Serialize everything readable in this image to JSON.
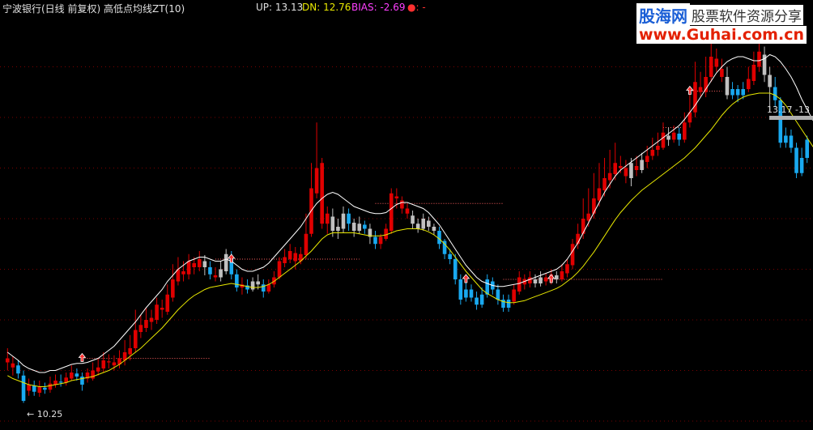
{
  "header": {
    "title": "宁波银行(日线 前复权) 高低点均线ZT(10)",
    "up_label": "UP: 13.13",
    "dn_label": "DN: 12.76",
    "bias_label": "BIAS: -2.69",
    "dot_label": "●: -"
  },
  "watermark": {
    "brand": "股海网",
    "tagline": "股票软件资源分享",
    "url": "www.Guhai.com.cn"
  },
  "colors": {
    "background": "#000000",
    "up_candle": "#e00000",
    "down_candle": "#19a9f0",
    "neutral_candle": "#c0c0c0",
    "upper_line": "#ffffff",
    "lower_line": "#e8e800",
    "grid": "#7a0000",
    "signal": "#ff6060"
  },
  "chart_data": {
    "type": "candlestick",
    "ylim": [
      10.0,
      14.0
    ],
    "grid": true,
    "annotations": {
      "low_label": "← 10.25",
      "high_label": "13.17 -13"
    },
    "candles": [
      [
        10.62,
        10.58,
        10.72,
        10.5,
        "r"
      ],
      [
        10.57,
        10.53,
        10.64,
        10.45,
        "r"
      ],
      [
        10.55,
        10.47,
        10.6,
        10.42,
        "b"
      ],
      [
        10.45,
        10.2,
        10.5,
        10.18,
        "b"
      ],
      [
        10.3,
        10.36,
        10.42,
        10.25,
        "r"
      ],
      [
        10.35,
        10.29,
        10.4,
        10.25,
        "b"
      ],
      [
        10.28,
        10.34,
        10.4,
        10.24,
        "r"
      ],
      [
        10.33,
        10.31,
        10.38,
        10.27,
        "b"
      ],
      [
        10.31,
        10.37,
        10.44,
        10.28,
        "r"
      ],
      [
        10.36,
        10.4,
        10.46,
        10.33,
        "r"
      ],
      [
        10.39,
        10.38,
        10.46,
        10.34,
        "b"
      ],
      [
        10.38,
        10.43,
        10.48,
        10.35,
        "r"
      ],
      [
        10.42,
        10.48,
        10.55,
        10.4,
        "r"
      ],
      [
        10.47,
        10.44,
        10.52,
        10.4,
        "b"
      ],
      [
        10.44,
        10.36,
        10.48,
        10.3,
        "b"
      ],
      [
        10.42,
        10.48,
        10.52,
        10.38,
        "r"
      ],
      [
        10.42,
        10.5,
        10.58,
        10.4,
        "r"
      ],
      [
        10.49,
        10.53,
        10.62,
        10.45,
        "r"
      ],
      [
        10.52,
        10.6,
        10.68,
        10.48,
        "r"
      ],
      [
        10.59,
        10.58,
        10.66,
        10.52,
        "r"
      ],
      [
        10.58,
        10.55,
        10.65,
        10.5,
        "r"
      ],
      [
        10.56,
        10.62,
        10.7,
        10.52,
        "r"
      ],
      [
        10.6,
        10.68,
        10.8,
        10.55,
        "r"
      ],
      [
        10.66,
        10.72,
        10.85,
        10.6,
        "r"
      ],
      [
        10.72,
        10.9,
        11.1,
        10.68,
        "r"
      ],
      [
        10.88,
        10.95,
        11.05,
        10.82,
        "r"
      ],
      [
        10.92,
        11.0,
        11.12,
        10.88,
        "r"
      ],
      [
        10.98,
        11.02,
        11.1,
        10.9,
        "r"
      ],
      [
        11.0,
        11.15,
        11.22,
        10.96,
        "r"
      ],
      [
        11.12,
        11.1,
        11.2,
        11.02,
        "r"
      ],
      [
        11.08,
        11.25,
        11.35,
        11.05,
        "r"
      ],
      [
        11.22,
        11.4,
        11.55,
        11.18,
        "r"
      ],
      [
        11.38,
        11.5,
        11.62,
        11.34,
        "r"
      ],
      [
        11.48,
        11.45,
        11.58,
        11.38,
        "r"
      ],
      [
        11.45,
        11.58,
        11.65,
        11.4,
        "r"
      ],
      [
        11.56,
        11.52,
        11.62,
        11.45,
        "r"
      ],
      [
        11.52,
        11.6,
        11.68,
        11.48,
        "r"
      ],
      [
        11.58,
        11.52,
        11.64,
        11.44,
        "g"
      ],
      [
        11.52,
        11.45,
        11.58,
        11.4,
        "b"
      ],
      [
        11.44,
        11.42,
        11.52,
        11.38,
        "r"
      ],
      [
        11.42,
        11.5,
        11.58,
        11.38,
        "g"
      ],
      [
        11.48,
        11.65,
        11.7,
        11.45,
        "g"
      ],
      [
        11.62,
        11.45,
        11.68,
        11.4,
        "b"
      ],
      [
        11.45,
        11.32,
        11.5,
        11.28,
        "b"
      ],
      [
        11.32,
        11.35,
        11.42,
        11.25,
        "r"
      ],
      [
        11.34,
        11.3,
        11.4,
        11.26,
        "b"
      ],
      [
        11.3,
        11.38,
        11.42,
        11.28,
        "g"
      ],
      [
        11.38,
        11.35,
        11.45,
        11.3,
        "g"
      ],
      [
        11.35,
        11.28,
        11.4,
        11.22,
        "b"
      ],
      [
        11.28,
        11.35,
        11.4,
        11.26,
        "r"
      ],
      [
        11.35,
        11.42,
        11.48,
        11.32,
        "r"
      ],
      [
        11.42,
        11.58,
        11.62,
        11.4,
        "r"
      ],
      [
        11.56,
        11.62,
        11.7,
        11.52,
        "r"
      ],
      [
        11.6,
        11.68,
        11.75,
        11.56,
        "r"
      ],
      [
        11.66,
        11.58,
        11.72,
        11.5,
        "r"
      ],
      [
        11.58,
        11.65,
        11.72,
        11.55,
        "r"
      ],
      [
        11.64,
        11.85,
        12.05,
        11.6,
        "r"
      ],
      [
        11.85,
        12.3,
        12.55,
        11.82,
        "r"
      ],
      [
        12.25,
        12.5,
        12.95,
        12.2,
        "r"
      ],
      [
        12.55,
        11.95,
        12.6,
        11.9,
        "r"
      ],
      [
        11.95,
        12.05,
        12.12,
        11.85,
        "r"
      ],
      [
        12.02,
        11.88,
        12.1,
        11.82,
        "g"
      ],
      [
        11.88,
        11.92,
        12.0,
        11.8,
        "g"
      ],
      [
        11.9,
        12.05,
        12.12,
        11.86,
        "g"
      ],
      [
        12.05,
        11.95,
        12.1,
        11.88,
        "b"
      ],
      [
        11.96,
        11.88,
        12.0,
        11.82,
        "g"
      ],
      [
        11.88,
        11.95,
        12.02,
        11.85,
        "g"
      ],
      [
        11.94,
        11.9,
        11.98,
        11.85,
        "b"
      ],
      [
        11.9,
        11.82,
        11.95,
        11.75,
        "g"
      ],
      [
        11.82,
        11.75,
        11.88,
        11.7,
        "b"
      ],
      [
        11.75,
        11.82,
        11.85,
        11.7,
        "r"
      ],
      [
        11.8,
        11.9,
        11.95,
        11.78,
        "r"
      ],
      [
        11.88,
        12.25,
        12.3,
        11.85,
        "r"
      ],
      [
        12.22,
        12.2,
        12.3,
        12.1,
        "r"
      ],
      [
        12.18,
        12.1,
        12.22,
        12.05,
        "r"
      ],
      [
        12.1,
        12.05,
        12.15,
        12.0,
        "r"
      ],
      [
        12.03,
        11.95,
        12.08,
        11.9,
        "g"
      ],
      [
        11.95,
        11.9,
        12.0,
        11.86,
        "g"
      ],
      [
        11.9,
        12.0,
        12.05,
        11.88,
        "g"
      ],
      [
        11.98,
        11.92,
        12.02,
        11.88,
        "g"
      ],
      [
        11.92,
        11.88,
        11.95,
        11.84,
        "g"
      ],
      [
        11.88,
        11.75,
        11.92,
        11.7,
        "b"
      ],
      [
        11.78,
        11.65,
        11.8,
        11.6,
        "b"
      ],
      [
        11.65,
        11.6,
        11.7,
        11.55,
        "b"
      ],
      [
        11.6,
        11.4,
        11.65,
        11.35,
        "b"
      ],
      [
        11.4,
        11.2,
        11.45,
        11.15,
        "b"
      ],
      [
        11.22,
        11.3,
        11.38,
        11.18,
        "b"
      ],
      [
        11.3,
        11.22,
        11.35,
        11.18,
        "b"
      ],
      [
        11.22,
        11.15,
        11.28,
        11.1,
        "b"
      ],
      [
        11.15,
        11.25,
        11.32,
        11.12,
        "b"
      ],
      [
        11.25,
        11.4,
        11.45,
        11.22,
        "b"
      ],
      [
        11.38,
        11.3,
        11.42,
        11.25,
        "b"
      ],
      [
        11.3,
        11.2,
        11.35,
        11.15,
        "b"
      ],
      [
        11.2,
        11.12,
        11.25,
        11.08,
        "b"
      ],
      [
        11.12,
        11.2,
        11.25,
        11.08,
        "b"
      ],
      [
        11.18,
        11.3,
        11.35,
        11.15,
        "r"
      ],
      [
        11.28,
        11.42,
        11.48,
        11.25,
        "r"
      ],
      [
        11.4,
        11.35,
        11.45,
        11.3,
        "r"
      ],
      [
        11.36,
        11.42,
        11.48,
        11.32,
        "r"
      ],
      [
        11.4,
        11.36,
        11.45,
        11.32,
        "g"
      ],
      [
        11.36,
        11.42,
        11.48,
        11.33,
        "g"
      ],
      [
        11.42,
        11.38,
        11.46,
        11.34,
        "r"
      ],
      [
        11.38,
        11.45,
        11.5,
        11.35,
        "r"
      ],
      [
        11.44,
        11.4,
        11.48,
        11.36,
        "g"
      ],
      [
        11.4,
        11.48,
        11.55,
        11.38,
        "r"
      ],
      [
        11.46,
        11.55,
        11.6,
        11.42,
        "r"
      ],
      [
        11.54,
        11.75,
        11.8,
        11.5,
        "r"
      ],
      [
        11.75,
        11.85,
        11.95,
        11.7,
        "r"
      ],
      [
        11.85,
        12.0,
        12.2,
        11.8,
        "r"
      ],
      [
        11.98,
        12.05,
        12.3,
        11.92,
        "r"
      ],
      [
        12.05,
        12.2,
        12.45,
        12.0,
        "r"
      ],
      [
        12.18,
        12.3,
        12.55,
        12.12,
        "r"
      ],
      [
        12.28,
        12.4,
        12.6,
        12.22,
        "r"
      ],
      [
        12.38,
        12.45,
        12.68,
        12.3,
        "r"
      ],
      [
        12.44,
        12.55,
        12.75,
        12.38,
        "r"
      ],
      [
        12.52,
        12.5,
        12.62,
        12.45,
        "r"
      ],
      [
        12.5,
        12.42,
        12.58,
        12.35,
        "r"
      ],
      [
        12.4,
        12.55,
        12.6,
        12.32,
        "g"
      ],
      [
        12.52,
        12.48,
        12.62,
        12.42,
        "r"
      ],
      [
        12.48,
        12.58,
        12.65,
        12.45,
        "g"
      ],
      [
        12.56,
        12.62,
        12.72,
        12.5,
        "r"
      ],
      [
        12.62,
        12.68,
        12.8,
        12.58,
        "r"
      ],
      [
        12.68,
        12.72,
        12.85,
        12.62,
        "r"
      ],
      [
        12.7,
        12.85,
        12.95,
        12.68,
        "r"
      ],
      [
        12.82,
        12.78,
        12.9,
        12.72,
        "g"
      ],
      [
        12.78,
        12.85,
        12.92,
        12.75,
        "r"
      ],
      [
        12.84,
        12.78,
        12.9,
        12.72,
        "b"
      ],
      [
        12.78,
        12.95,
        13.05,
        12.75,
        "r"
      ],
      [
        12.95,
        13.05,
        13.25,
        12.9,
        "r"
      ],
      [
        13.05,
        13.35,
        13.55,
        13.0,
        "r"
      ],
      [
        13.3,
        13.25,
        13.45,
        13.2,
        "r"
      ],
      [
        13.25,
        13.4,
        13.6,
        13.2,
        "r"
      ],
      [
        13.4,
        13.6,
        13.75,
        13.35,
        "r"
      ],
      [
        13.58,
        13.5,
        13.68,
        13.45,
        "r"
      ],
      [
        13.48,
        13.4,
        13.58,
        13.35,
        "r"
      ],
      [
        13.4,
        13.22,
        13.5,
        13.18,
        "g"
      ],
      [
        13.22,
        13.28,
        13.35,
        13.18,
        "b"
      ],
      [
        13.28,
        13.22,
        13.32,
        13.15,
        "b"
      ],
      [
        13.22,
        13.28,
        13.35,
        13.18,
        "b"
      ],
      [
        13.28,
        13.38,
        13.5,
        13.25,
        "r"
      ],
      [
        13.36,
        13.52,
        13.65,
        13.32,
        "r"
      ],
      [
        13.5,
        13.65,
        13.78,
        13.45,
        "r"
      ],
      [
        13.62,
        13.42,
        13.7,
        13.35,
        "g"
      ],
      [
        13.42,
        13.3,
        13.5,
        13.05,
        "g"
      ],
      [
        13.3,
        13.17,
        13.4,
        13.1,
        "b"
      ],
      [
        13.17,
        12.75,
        13.2,
        12.7,
        "b"
      ],
      [
        12.75,
        12.82,
        12.9,
        12.7,
        "b"
      ],
      [
        12.82,
        12.7,
        12.88,
        12.65,
        "b"
      ],
      [
        12.7,
        12.45,
        12.75,
        12.4,
        "b"
      ],
      [
        12.45,
        12.6,
        12.7,
        12.42,
        "b"
      ],
      [
        12.6,
        12.78,
        12.82,
        12.55,
        "b"
      ]
    ],
    "upper_line": [
      10.68,
      10.64,
      10.6,
      10.55,
      10.52,
      10.5,
      10.48,
      10.48,
      10.5,
      10.5,
      10.52,
      10.54,
      10.56,
      10.57,
      10.57,
      10.58,
      10.6,
      10.62,
      10.66,
      10.7,
      10.74,
      10.8,
      10.86,
      10.92,
      10.98,
      11.05,
      11.12,
      11.18,
      11.24,
      11.3,
      11.38,
      11.44,
      11.5,
      11.54,
      11.58,
      11.6,
      11.62,
      11.62,
      11.6,
      11.58,
      11.58,
      11.6,
      11.58,
      11.54,
      11.5,
      11.48,
      11.48,
      11.5,
      11.52,
      11.56,
      11.62,
      11.68,
      11.74,
      11.8,
      11.86,
      11.92,
      12.0,
      12.08,
      12.15,
      12.2,
      12.24,
      12.26,
      12.24,
      12.2,
      12.16,
      12.12,
      12.1,
      12.08,
      12.06,
      12.05,
      12.05,
      12.06,
      12.1,
      12.14,
      12.16,
      12.16,
      12.14,
      12.12,
      12.1,
      12.06,
      12.0,
      11.94,
      11.86,
      11.78,
      11.7,
      11.62,
      11.54,
      11.48,
      11.42,
      11.38,
      11.36,
      11.34,
      11.33,
      11.33,
      11.34,
      11.35,
      11.36,
      11.38,
      11.4,
      11.42,
      11.44,
      11.46,
      11.48,
      11.5,
      11.54,
      11.6,
      11.68,
      11.76,
      11.86,
      11.96,
      12.06,
      12.16,
      12.26,
      12.34,
      12.42,
      12.48,
      12.52,
      12.56,
      12.6,
      12.64,
      12.68,
      12.72,
      12.76,
      12.8,
      12.84,
      12.88,
      12.92,
      12.98,
      13.05,
      13.12,
      13.2,
      13.28,
      13.36,
      13.44,
      13.5,
      13.55,
      13.58,
      13.6,
      13.6,
      13.58,
      13.56,
      13.56,
      13.58,
      13.62,
      13.6,
      13.55,
      13.48,
      13.4,
      13.3,
      13.18,
      13.08,
      12.98,
      12.9
    ],
    "lower_line": [
      10.45,
      10.42,
      10.4,
      10.38,
      10.36,
      10.35,
      10.34,
      10.34,
      10.35,
      10.36,
      10.37,
      10.38,
      10.4,
      10.41,
      10.42,
      10.43,
      10.44,
      10.46,
      10.48,
      10.5,
      10.53,
      10.56,
      10.6,
      10.64,
      10.68,
      10.72,
      10.77,
      10.82,
      10.87,
      10.92,
      10.98,
      11.04,
      11.1,
      11.15,
      11.2,
      11.24,
      11.27,
      11.3,
      11.32,
      11.33,
      11.34,
      11.35,
      11.36,
      11.35,
      11.34,
      11.33,
      11.32,
      11.32,
      11.33,
      11.35,
      11.38,
      11.42,
      11.46,
      11.5,
      11.54,
      11.58,
      11.63,
      11.68,
      11.74,
      11.8,
      11.84,
      11.86,
      11.86,
      11.86,
      11.86,
      11.86,
      11.85,
      11.84,
      11.83,
      11.83,
      11.83,
      11.84,
      11.86,
      11.88,
      11.89,
      11.9,
      11.9,
      11.9,
      11.89,
      11.87,
      11.84,
      11.8,
      11.75,
      11.69,
      11.62,
      11.55,
      11.48,
      11.42,
      11.36,
      11.3,
      11.26,
      11.23,
      11.2,
      11.18,
      11.17,
      11.17,
      11.18,
      11.19,
      11.21,
      11.23,
      11.25,
      11.27,
      11.29,
      11.31,
      11.34,
      11.38,
      11.42,
      11.47,
      11.53,
      11.6,
      11.67,
      11.75,
      11.83,
      11.91,
      11.99,
      12.06,
      12.12,
      12.18,
      12.23,
      12.28,
      12.32,
      12.36,
      12.4,
      12.44,
      12.48,
      12.52,
      12.56,
      12.6,
      12.65,
      12.7,
      12.76,
      12.82,
      12.88,
      12.95,
      13.02,
      13.08,
      13.13,
      13.17,
      13.2,
      13.22,
      13.23,
      13.24,
      13.24,
      13.24,
      13.22,
      13.18,
      13.12,
      13.04,
      12.96,
      12.88,
      12.8,
      12.72,
      12.64
    ],
    "signals": [
      {
        "candle": 14,
        "level": 10.62
      },
      {
        "candle": 42,
        "level": 11.6
      },
      {
        "candle": 86,
        "level": 11.4
      },
      {
        "candle": 102,
        "level": 11.4
      },
      {
        "candle": 128,
        "level": 13.26
      }
    ],
    "hlines": [
      {
        "from": 14,
        "to": 38,
        "level": 10.62
      },
      {
        "from": 39,
        "to": 66,
        "level": 11.6
      },
      {
        "from": 69,
        "to": 93,
        "level": 12.15
      },
      {
        "from": 93,
        "to": 123,
        "level": 11.4
      },
      {
        "from": 123,
        "to": 127,
        "level": 12.9
      },
      {
        "from": 128,
        "to": 134,
        "level": 13.26
      }
    ]
  }
}
